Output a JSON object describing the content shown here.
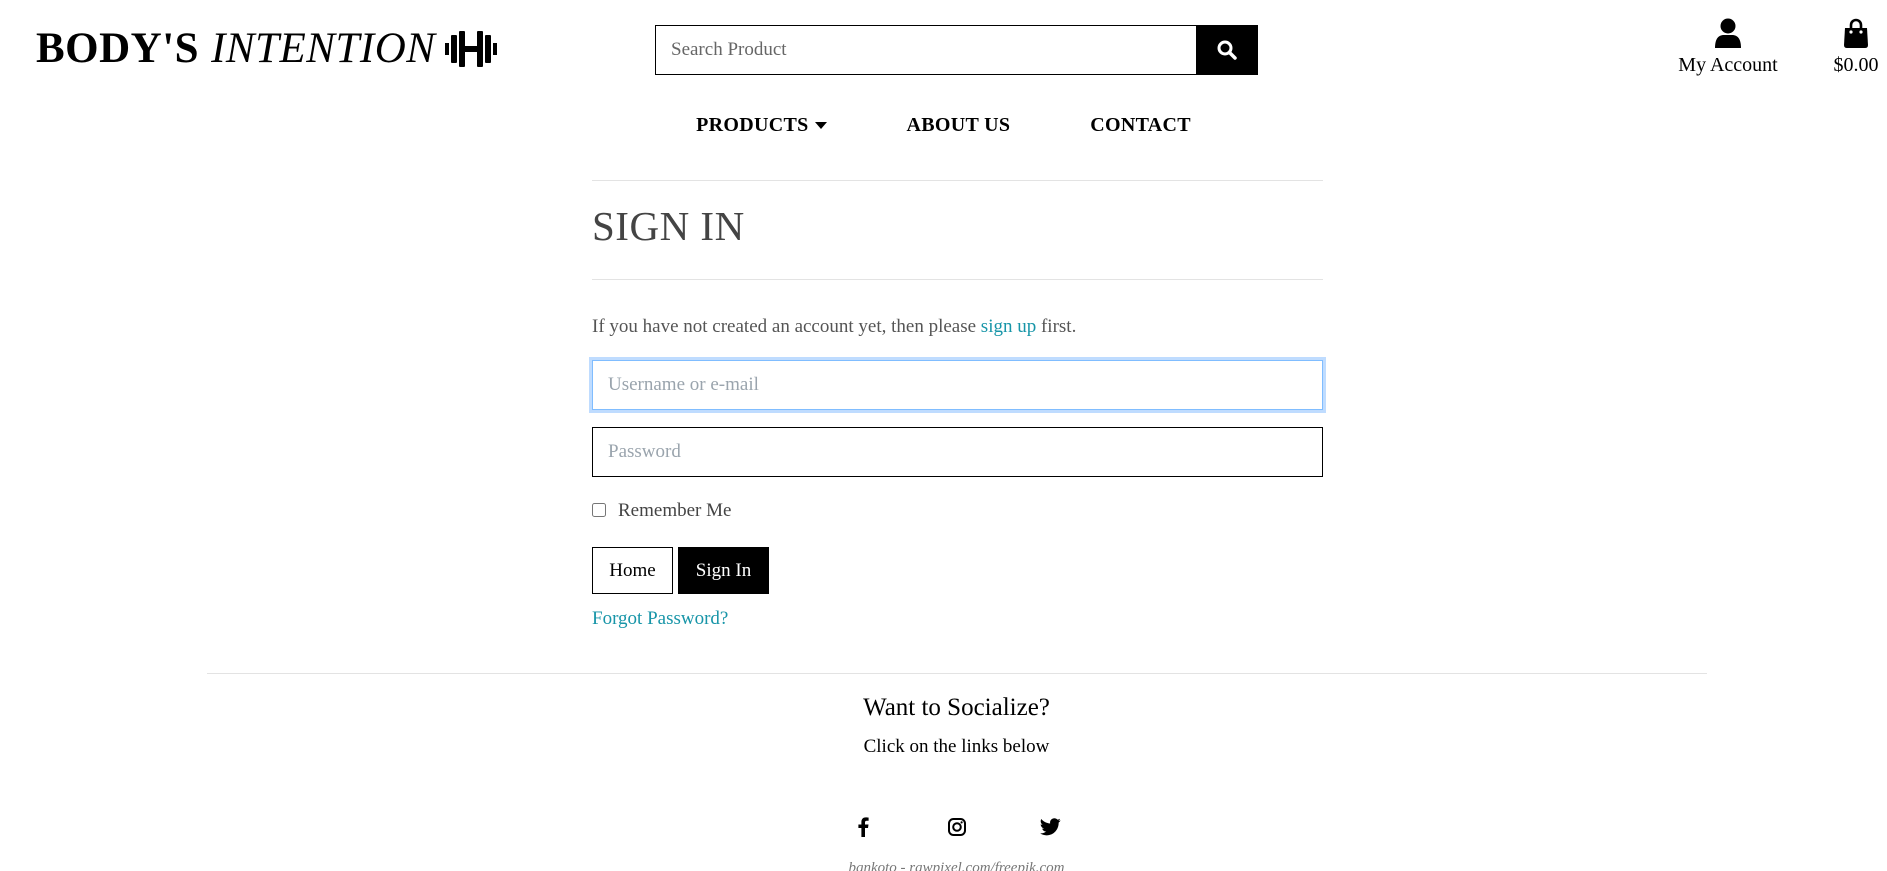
{
  "brand": {
    "bold": "BODY'S",
    "italic": "INTENTION",
    "icon": "dumbbell-icon"
  },
  "search": {
    "placeholder": "Search Product",
    "icon": "search-icon"
  },
  "header": {
    "account_label": "My Account",
    "account_icon": "user-icon",
    "cart_total": "$0.00",
    "cart_icon": "shopping-bag-icon"
  },
  "nav": {
    "products": "PRODUCTS",
    "about": "ABOUT US",
    "contact": "CONTACT"
  },
  "signin": {
    "title": "SIGN IN",
    "intro_before": "If you have not created an account yet, then please ",
    "intro_link": "sign up",
    "intro_after": " first.",
    "username_placeholder": "Username or e-mail",
    "password_placeholder": "Password",
    "remember_label": "Remember Me",
    "remember_checked": false,
    "home_button": "Home",
    "signin_button": "Sign In",
    "forgot_link": "Forgot Password?"
  },
  "footer": {
    "title": "Want to Socialize?",
    "subtitle": "Click on the links below",
    "social_icons": [
      "facebook-icon",
      "instagram-icon",
      "twitter-icon"
    ],
    "credit": "bgnkoto - rawpixel.com/freepik.com"
  },
  "colors": {
    "link": "#1795a8",
    "focus_ring": "#bfdcff",
    "button_dark": "#000000"
  }
}
